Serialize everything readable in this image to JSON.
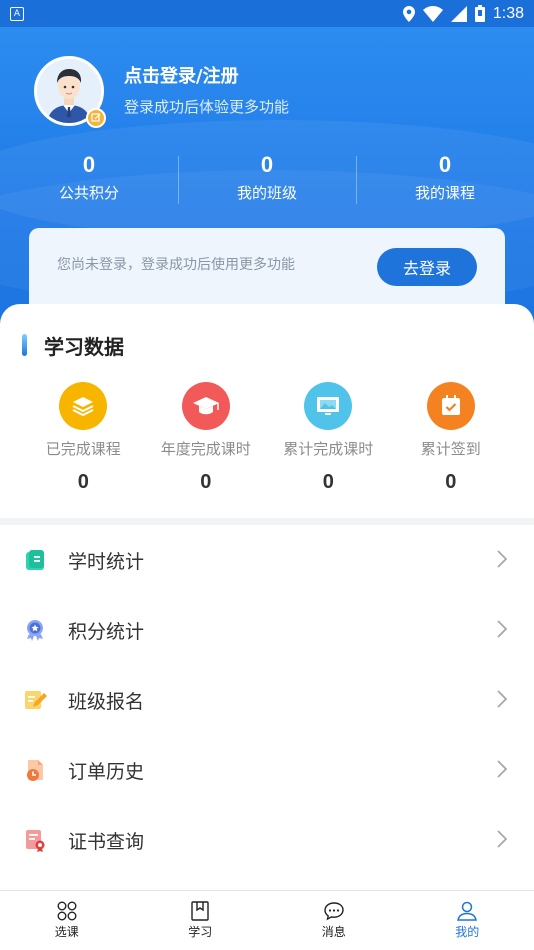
{
  "status_bar": {
    "left_icon_letter": "A",
    "time": "1:38"
  },
  "profile": {
    "login_title": "点击登录/注册",
    "login_subtitle": "登录成功后体验更多功能"
  },
  "stats": [
    {
      "value": "0",
      "label": "公共积分"
    },
    {
      "value": "0",
      "label": "我的班级"
    },
    {
      "value": "0",
      "label": "我的课程"
    }
  ],
  "notice": {
    "text": "您尚未登录，登录成功后使用更多功能",
    "button_label": "去登录"
  },
  "study_data": {
    "title": "学习数据",
    "items": [
      {
        "label": "已完成课程",
        "value": "0",
        "color": "#f7b500"
      },
      {
        "label": "年度完成课时",
        "value": "0",
        "color": "#f25a5a"
      },
      {
        "label": "累计完成课时",
        "value": "0",
        "color": "#4fc3ea"
      },
      {
        "label": "累计签到",
        "value": "0",
        "color": "#f58220"
      }
    ]
  },
  "menu": [
    {
      "label": "学时统计",
      "icon": "notebook-icon"
    },
    {
      "label": "积分统计",
      "icon": "medal-icon"
    },
    {
      "label": "班级报名",
      "icon": "edit-note-icon"
    },
    {
      "label": "订单历史",
      "icon": "order-clock-icon"
    },
    {
      "label": "证书查询",
      "icon": "certificate-icon"
    }
  ],
  "tabbar": [
    {
      "label": "选课",
      "icon": "grid-icon",
      "active": false
    },
    {
      "label": "学习",
      "icon": "book-icon",
      "active": false
    },
    {
      "label": "消息",
      "icon": "chat-icon",
      "active": false
    },
    {
      "label": "我的",
      "icon": "person-icon",
      "active": true
    }
  ],
  "colors": {
    "primary": "#1f74dc",
    "header_gradient_top": "#2f8ff0",
    "accent_yellow": "#f5b43a"
  }
}
